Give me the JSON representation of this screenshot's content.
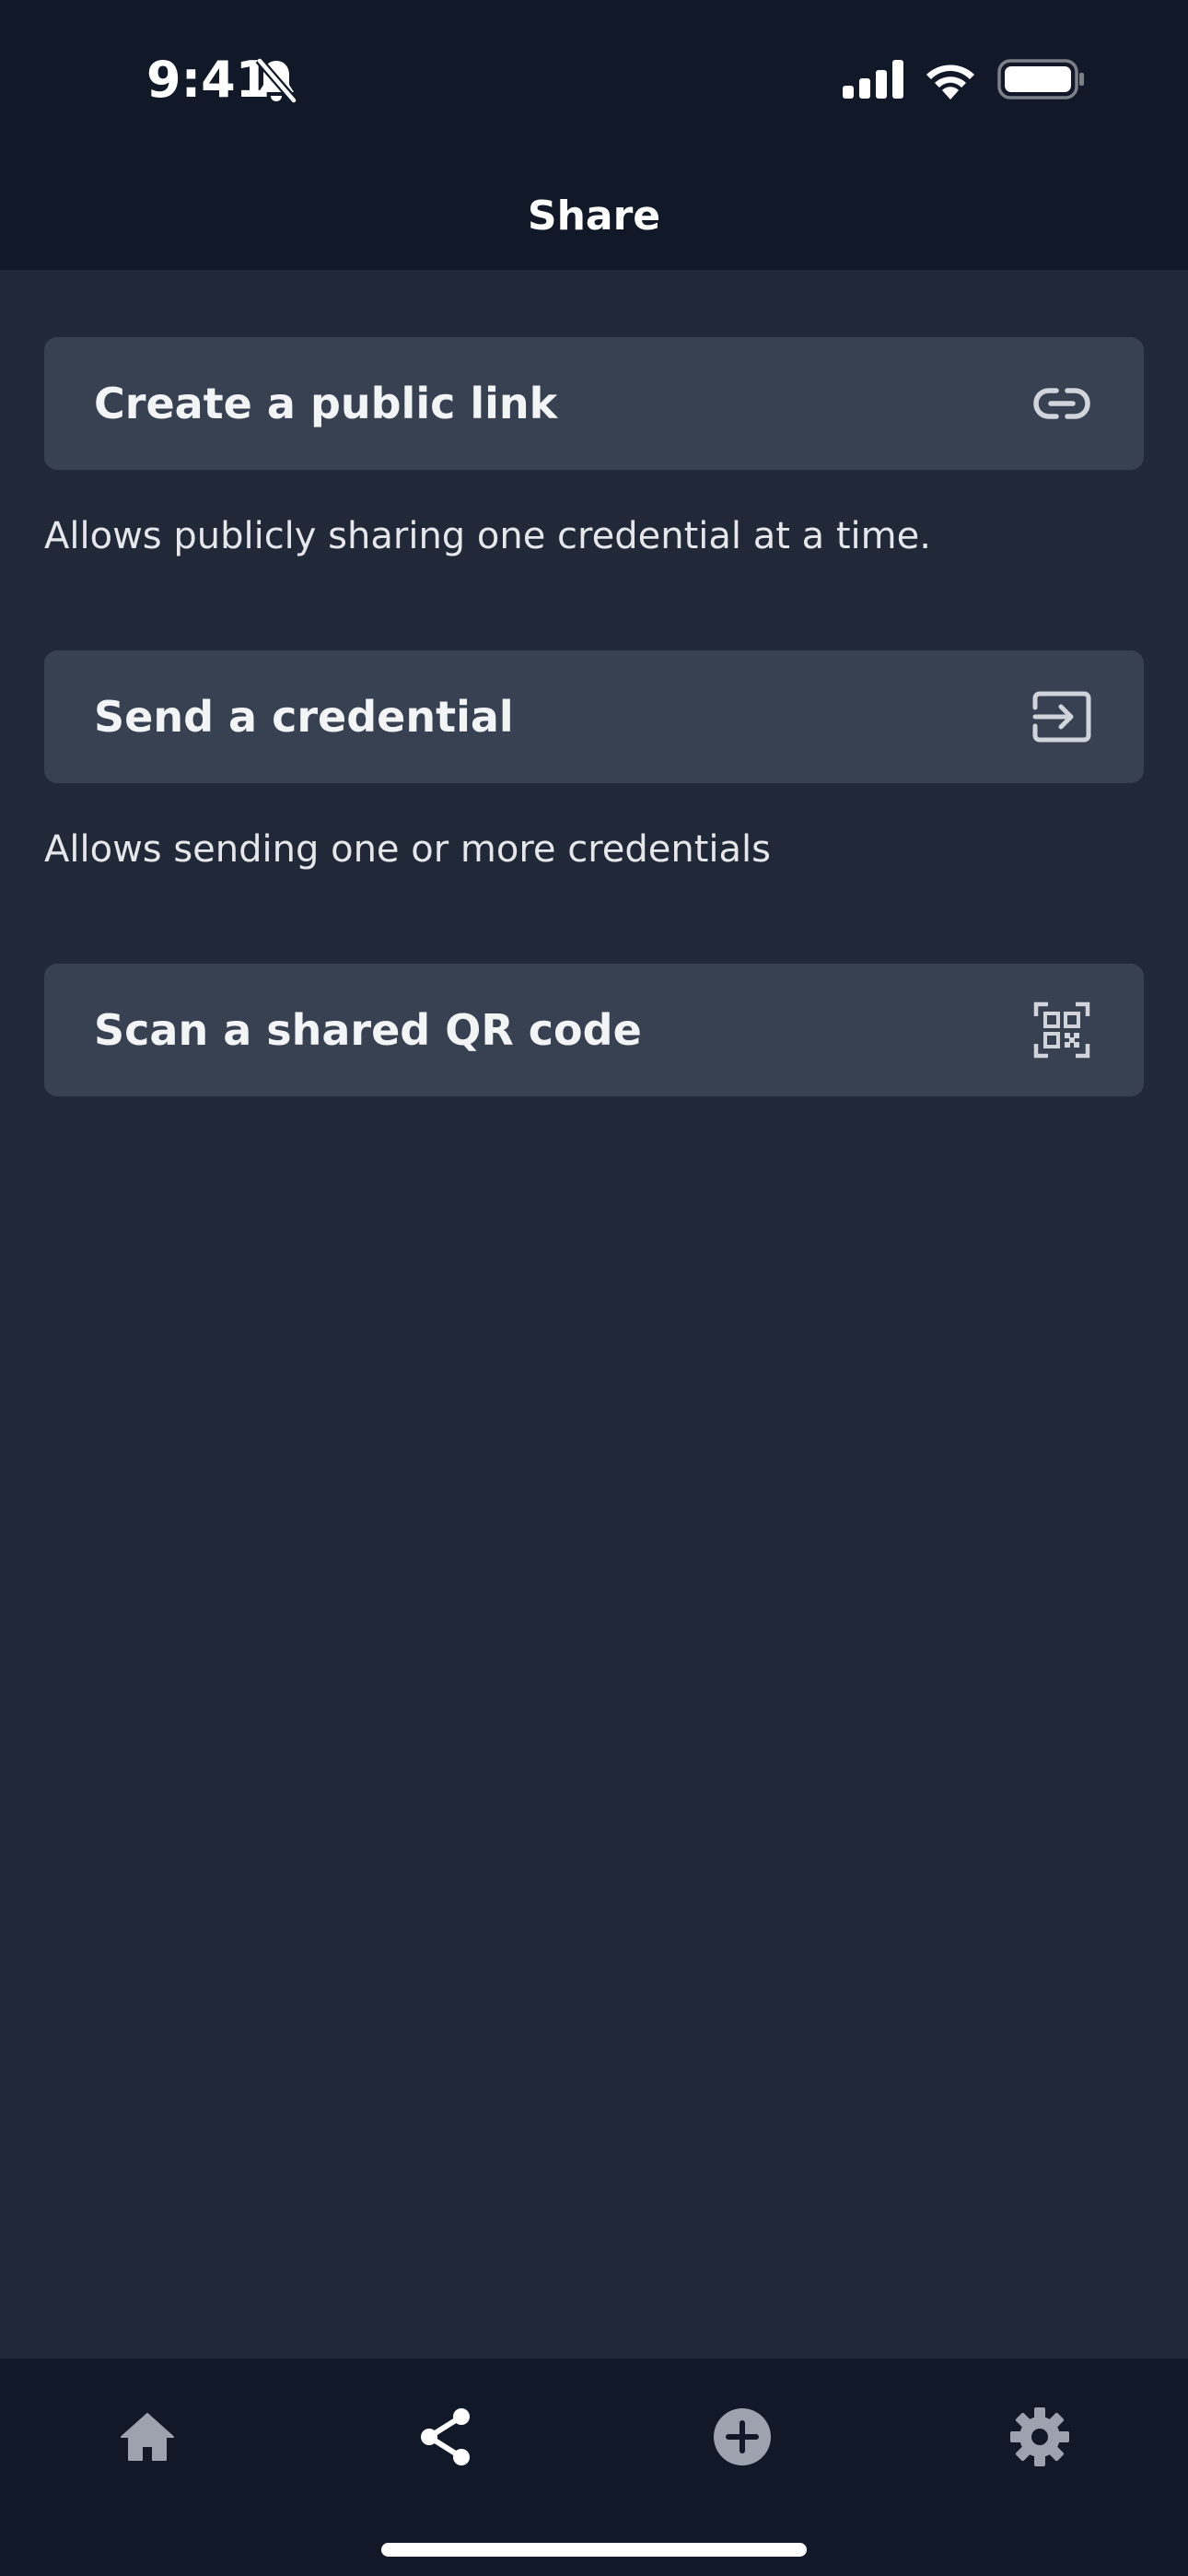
{
  "status_bar": {
    "time": "9:41"
  },
  "header": {
    "title": "Share"
  },
  "options": [
    {
      "label": "Create a public link",
      "description": "Allows publicly sharing one credential at a time.",
      "icon": "link-icon"
    },
    {
      "label": "Send a credential",
      "description": "Allows sending one or more credentials",
      "icon": "send-icon"
    },
    {
      "label": "Scan a shared QR code",
      "icon": "qr-code-icon"
    }
  ],
  "tab_bar": {
    "tabs": [
      {
        "icon": "home-icon",
        "active": false
      },
      {
        "icon": "share-icon",
        "active": true
      },
      {
        "icon": "add-icon",
        "active": false
      },
      {
        "icon": "settings-icon",
        "active": false
      }
    ],
    "active_color": "#ffffff",
    "inactive_color": "#9ca3af"
  },
  "colors": {
    "background": "#212938",
    "header_background": "#111827",
    "button_background": "#374151"
  }
}
